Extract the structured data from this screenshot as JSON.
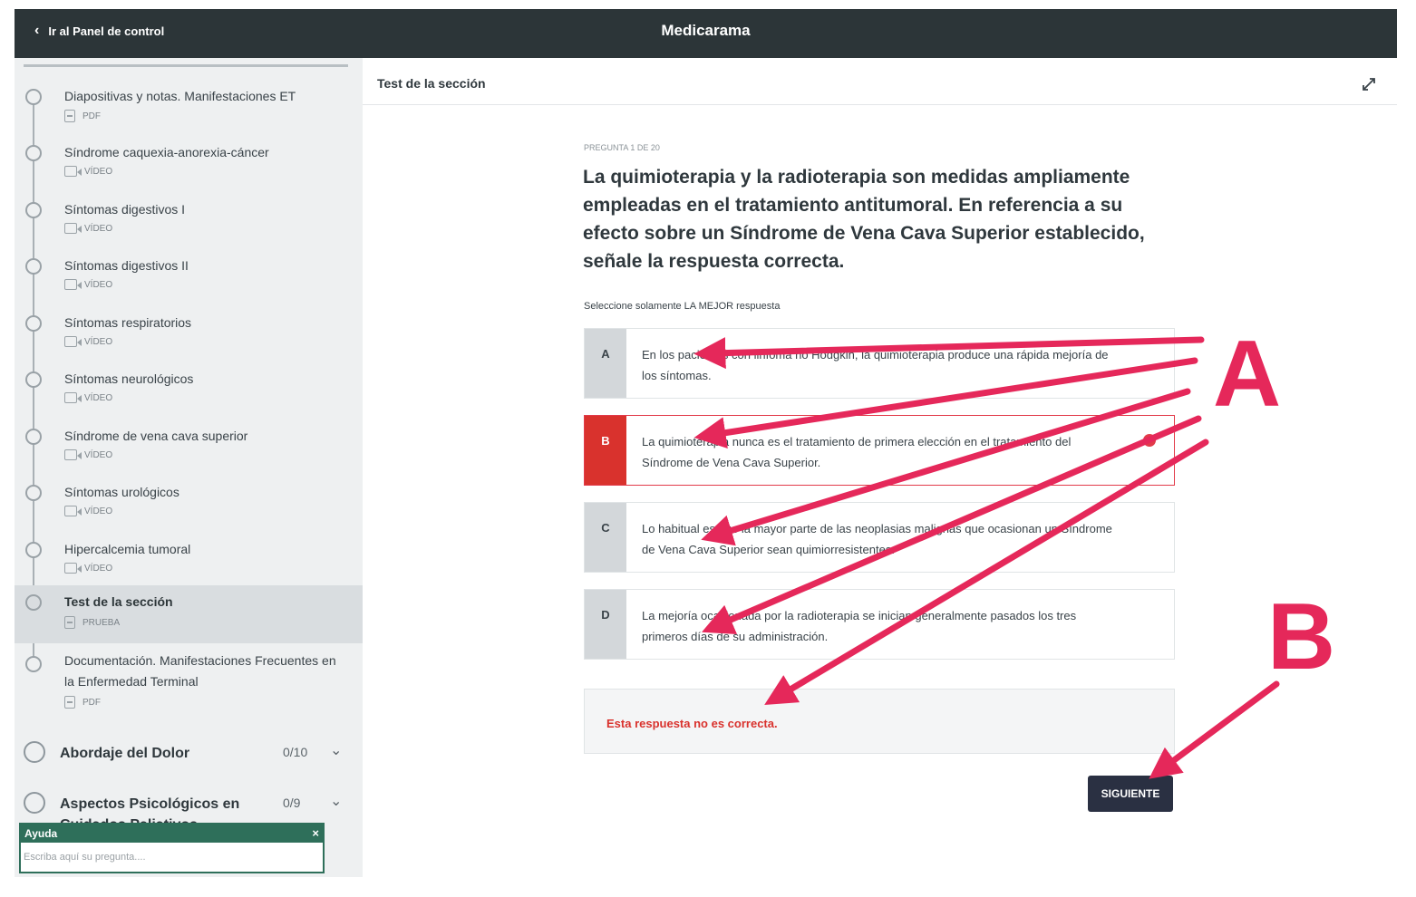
{
  "topbar": {
    "back_label": "Ir al Panel de control",
    "app_title": "Medicarama"
  },
  "sidebar": {
    "items": [
      {
        "title": "Diapositivas y notas. Manifestaciones ET",
        "type": "PDF",
        "icon": "document-icon"
      },
      {
        "title": "Síndrome caquexia-anorexia-cáncer",
        "type": "VÍDEO",
        "icon": "video-icon"
      },
      {
        "title": "Síntomas digestivos I",
        "type": "VÍDEO",
        "icon": "video-icon"
      },
      {
        "title": "Síntomas digestivos II",
        "type": "VÍDEO",
        "icon": "video-icon"
      },
      {
        "title": "Síntomas respiratorios",
        "type": "VÍDEO",
        "icon": "video-icon"
      },
      {
        "title": "Síntomas neurológicos",
        "type": "VÍDEO",
        "icon": "video-icon"
      },
      {
        "title": "Síndrome de vena cava superior",
        "type": "VÍDEO",
        "icon": "video-icon"
      },
      {
        "title": "Síntomas urológicos",
        "type": "VÍDEO",
        "icon": "video-icon"
      },
      {
        "title": "Hipercalcemia tumoral",
        "type": "VÍDEO",
        "icon": "video-icon"
      },
      {
        "title": "Test de la sección",
        "type": "PRUEBA",
        "icon": "document-icon",
        "active": true
      },
      {
        "title": "Documentación. Manifestaciones Frecuentes en la Enfermedad Terminal",
        "type": "PDF",
        "icon": "document-icon"
      }
    ],
    "sections": [
      {
        "title": "Abordaje del Dolor",
        "count": "0/10"
      },
      {
        "title": "Aspectos Psicológicos en Cuidados Paliativos",
        "count": "0/9"
      }
    ]
  },
  "help": {
    "title": "Ayuda",
    "close": "×",
    "placeholder": "Escriba aquí su pregunta...."
  },
  "main": {
    "section_label": "Test de la sección",
    "counter": "PREGUNTA 1 DE 20",
    "question": "La quimioterapia y la radioterapia son medidas ampliamente empleadas en el tratamiento antitumoral. En referencia a su efecto sobre un Síndrome de Vena Cava Superior establecido, señale la respuesta correcta.",
    "instruction": "Seleccione solamente LA MEJOR respuesta",
    "options": [
      {
        "letter": "A",
        "text": "En los pacientes con linfoma no Hodgkin, la quimioterapia produce una rápida mejoría de los síntomas."
      },
      {
        "letter": "B",
        "text": "La quimioterapia nunca es el tratamiento de primera elección en el tratamiento del Síndrome de Vena Cava Superior.",
        "selected": true
      },
      {
        "letter": "C",
        "text": "Lo habitual es que la mayor parte de las neoplasias malignas que ocasionan un Síndrome de Vena Cava Superior sean quimiorresistentes."
      },
      {
        "letter": "D",
        "text": "La mejoría ocasionada por la radioterapia se inician generalmente pasados los tres primeros días de su administración."
      }
    ],
    "feedback": "Esta respuesta no es correcta.",
    "next_label": "SIGUIENTE"
  },
  "annotations": {
    "label_a": "A",
    "label_b": "B",
    "color": "#e5285a"
  }
}
